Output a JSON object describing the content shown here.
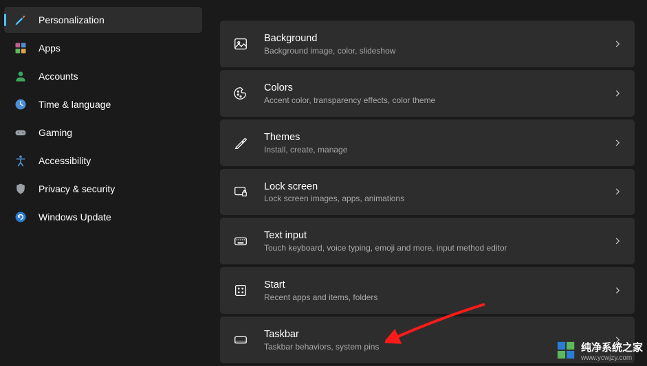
{
  "sidebar": {
    "items": [
      {
        "label": "Personalization"
      },
      {
        "label": "Apps"
      },
      {
        "label": "Accounts"
      },
      {
        "label": "Time & language"
      },
      {
        "label": "Gaming"
      },
      {
        "label": "Accessibility"
      },
      {
        "label": "Privacy & security"
      },
      {
        "label": "Windows Update"
      }
    ]
  },
  "main": {
    "rows": [
      {
        "title": "Background",
        "sub": "Background image, color, slideshow"
      },
      {
        "title": "Colors",
        "sub": "Accent color, transparency effects, color theme"
      },
      {
        "title": "Themes",
        "sub": "Install, create, manage"
      },
      {
        "title": "Lock screen",
        "sub": "Lock screen images, apps, animations"
      },
      {
        "title": "Text input",
        "sub": "Touch keyboard, voice typing, emoji and more, input method editor"
      },
      {
        "title": "Start",
        "sub": "Recent apps and items, folders"
      },
      {
        "title": "Taskbar",
        "sub": "Taskbar behaviors, system pins"
      }
    ]
  },
  "watermark": {
    "text": "纯净系统之家",
    "url": "www.ycwjzy.com"
  }
}
